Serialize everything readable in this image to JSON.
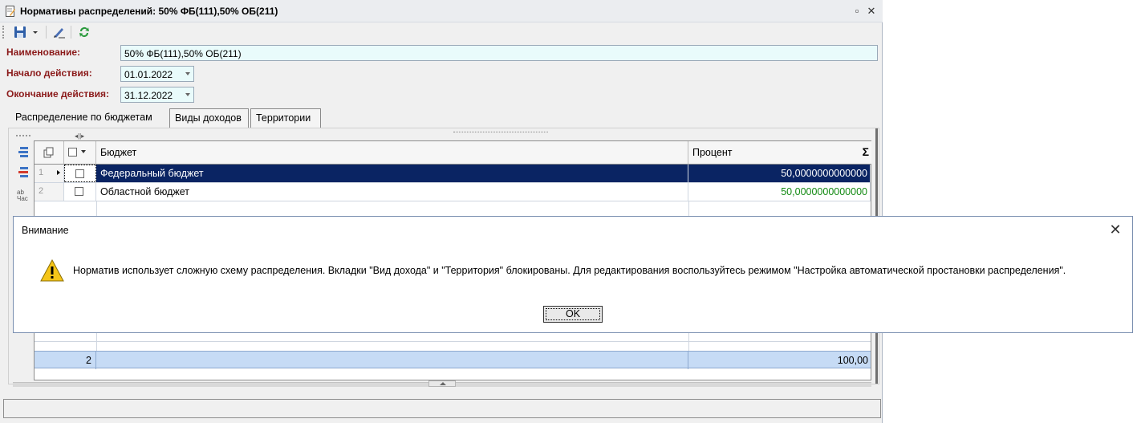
{
  "window": {
    "title": "Нормативы распределений: 50% ФБ(111),50% ОБ(211)",
    "controls": [
      "restore-icon",
      "close-icon"
    ]
  },
  "toolbar": {
    "buttons": [
      "save-icon",
      "dropdown-icon",
      "edit-icon",
      "refresh-icon"
    ]
  },
  "form": {
    "name_label": "Наименование:",
    "name_value": "50% ФБ(111),50% ОБ(211)",
    "start_label": "Начало действия:",
    "start_value": "01.01.2022",
    "end_label": "Окончание действия:",
    "end_value": "31.12.2022"
  },
  "tabs": [
    {
      "label": "Распределение по бюджетам",
      "active": true
    },
    {
      "label": "Виды доходов",
      "active": false
    },
    {
      "label": "Территории",
      "active": false
    }
  ],
  "grid": {
    "columns": {
      "budget": "Бюджет",
      "percent": "Процент",
      "sum_symbol": "Σ"
    },
    "rows": [
      {
        "num": "1",
        "budget": "Федеральный бюджет",
        "percent": "50,0000000000000",
        "selected": true
      },
      {
        "num": "2",
        "budget": "Областной бюджет",
        "percent": "50,0000000000000",
        "selected": false
      }
    ],
    "footer": {
      "count": "2",
      "total": "100,00"
    }
  },
  "dialog": {
    "title": "Внимание",
    "message": "Норматив использует сложную схему распределения. Вкладки \"Вид дохода\" и \"Территория\" блокированы. Для редактирования воспользуйтесь режимом \"Настройка автоматической простановки распределения\".",
    "ok_label": "OK",
    "icon": "warning-icon"
  },
  "colors": {
    "label_red": "#8b1a1a",
    "selected_row": "#0a2463",
    "percent_green": "#138a13",
    "footer_blue": "#c6dbf5",
    "field_bg": "#e9fbfb"
  }
}
